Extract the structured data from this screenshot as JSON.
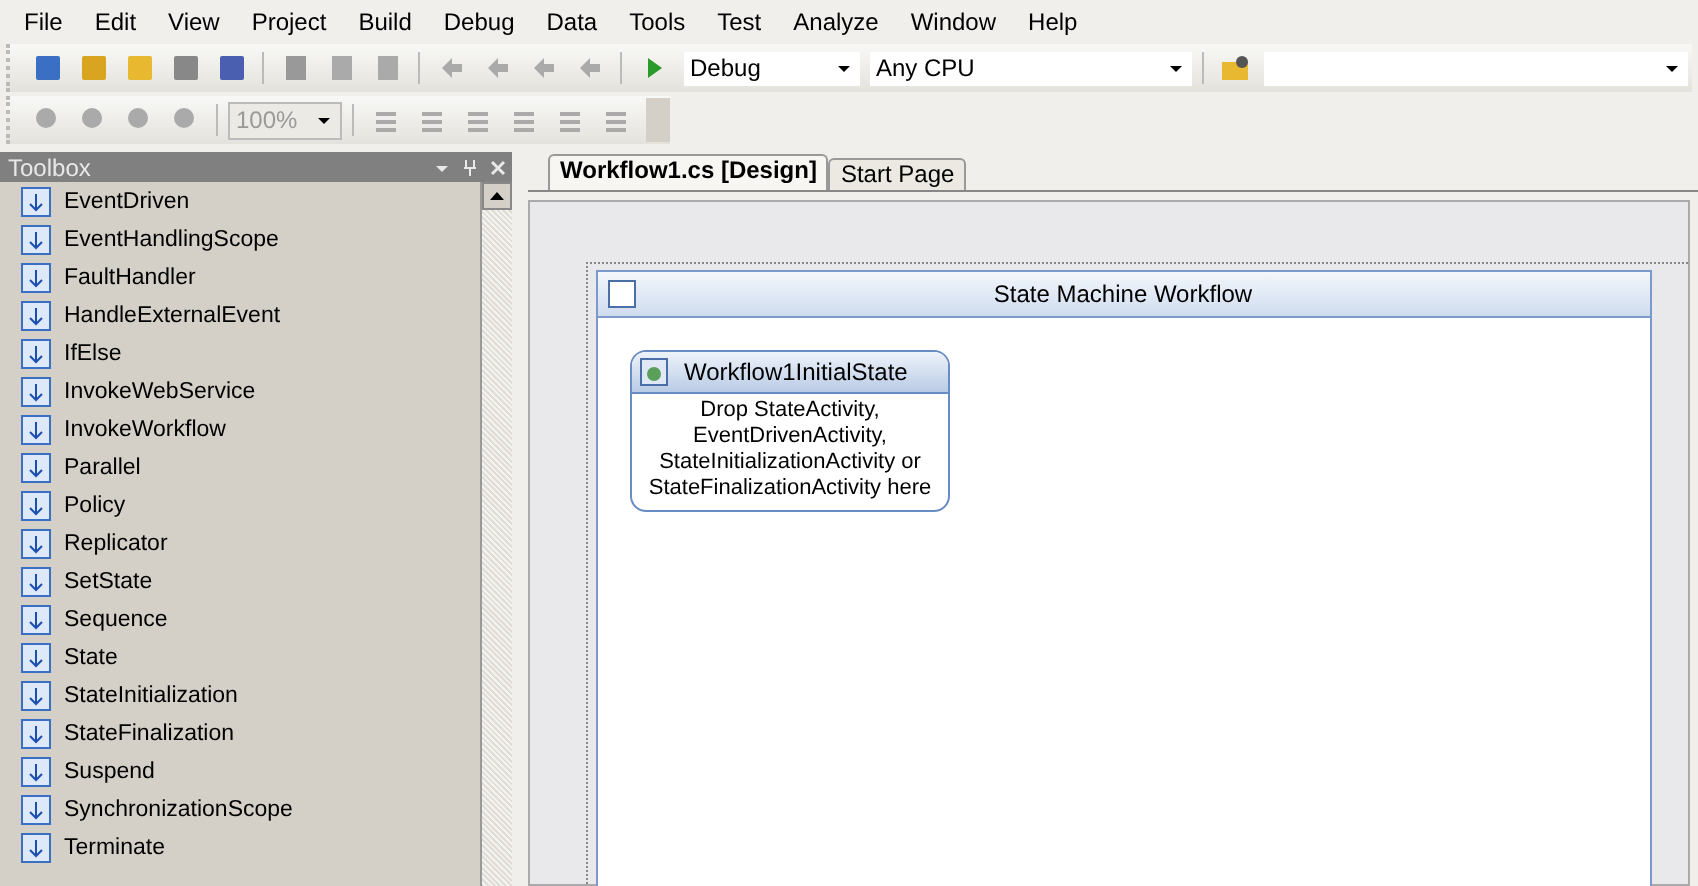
{
  "menu": [
    "File",
    "Edit",
    "View",
    "Project",
    "Build",
    "Debug",
    "Data",
    "Tools",
    "Test",
    "Analyze",
    "Window",
    "Help"
  ],
  "toolbar": {
    "configuration": "Debug",
    "platform": "Any CPU",
    "zoom": "100%"
  },
  "toolbox": {
    "title": "Toolbox",
    "items": [
      "EventDriven",
      "EventHandlingScope",
      "FaultHandler",
      "HandleExternalEvent",
      "IfElse",
      "InvokeWebService",
      "InvokeWorkflow",
      "Parallel",
      "Policy",
      "Replicator",
      "SetState",
      "Sequence",
      "State",
      "StateInitialization",
      "StateFinalization",
      "Suspend",
      "SynchronizationScope",
      "Terminate"
    ]
  },
  "tabs": [
    {
      "label": "Workflow1.cs [Design]",
      "selected": true
    },
    {
      "label": "Start Page",
      "selected": false
    }
  ],
  "designer": {
    "title": "State Machine Workflow",
    "state": {
      "title": "Workflow1InitialState",
      "hint": "Drop StateActivity, EventDrivenActivity, StateInitializationActivity or StateFinalizationActivity here"
    }
  }
}
